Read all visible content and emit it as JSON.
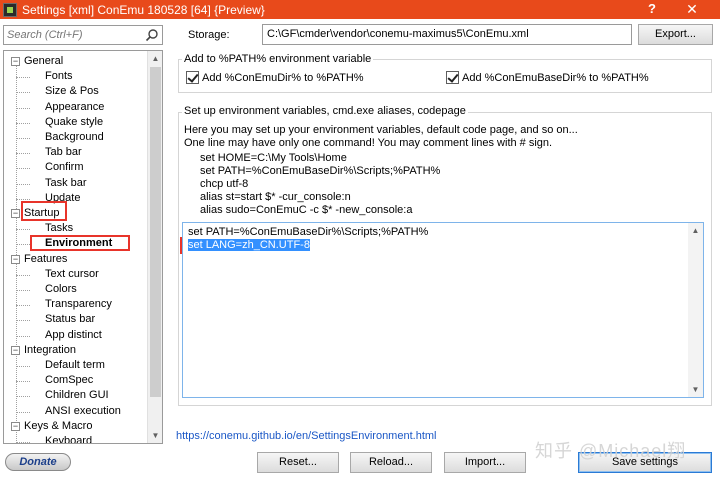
{
  "window": {
    "title": "Settings [xml] ConEmu 180528 [64] {Preview}",
    "help_label": "?",
    "close_label": "✕",
    "accent": "#e84a1b"
  },
  "search": {
    "placeholder": "Search (Ctrl+F)"
  },
  "tree": [
    {
      "label": "General",
      "level": 0,
      "expander": "−"
    },
    {
      "label": "Fonts",
      "level": 1
    },
    {
      "label": "Size & Pos",
      "level": 1
    },
    {
      "label": "Appearance",
      "level": 1
    },
    {
      "label": "Quake style",
      "level": 1
    },
    {
      "label": "Background",
      "level": 1
    },
    {
      "label": "Tab bar",
      "level": 1
    },
    {
      "label": "Confirm",
      "level": 1
    },
    {
      "label": "Task bar",
      "level": 1
    },
    {
      "label": "Update",
      "level": 1
    },
    {
      "label": "Startup",
      "level": 0,
      "expander": "−"
    },
    {
      "label": "Tasks",
      "level": 1
    },
    {
      "label": "Environment",
      "level": 1,
      "selected": true
    },
    {
      "label": "Features",
      "level": 0,
      "expander": "−"
    },
    {
      "label": "Text cursor",
      "level": 1
    },
    {
      "label": "Colors",
      "level": 1
    },
    {
      "label": "Transparency",
      "level": 1
    },
    {
      "label": "Status bar",
      "level": 1
    },
    {
      "label": "App distinct",
      "level": 1
    },
    {
      "label": "Integration",
      "level": 0,
      "expander": "−"
    },
    {
      "label": "Default term",
      "level": 1
    },
    {
      "label": "ComSpec",
      "level": 1
    },
    {
      "label": "Children GUI",
      "level": 1
    },
    {
      "label": "ANSI execution",
      "level": 1
    },
    {
      "label": "Keys & Macro",
      "level": 0,
      "expander": "−"
    },
    {
      "label": "Keyboard",
      "level": 1
    }
  ],
  "storage": {
    "label": "Storage:",
    "value": "C:\\GF\\cmder\\vendor\\conemu-maximus5\\ConEmu.xml",
    "export_label": "Export..."
  },
  "path_group": {
    "title": "Add to %PATH% environment variable",
    "check1": "Add %ConEmuDir% to %PATH%",
    "check2": "Add %ConEmuBaseDir% to %PATH%"
  },
  "env_group": {
    "title": "Set up environment variables, cmd.exe aliases, codepage",
    "desc1": "Here you may set up your environment variables, default code page, and so on...",
    "desc2": "One line may have only one command! You may comment lines with # sign.",
    "examples": [
      "set HOME=C:\\My Tools\\Home",
      "set PATH=%ConEmuBaseDir%\\Scripts;%PATH%",
      "chcp utf-8",
      "alias st=start $* -cur_console:n",
      "alias sudo=ConEmuC -c $* -new_console:a"
    ],
    "editor_lines": [
      "set PATH=%ConEmuBaseDir%\\Scripts;%PATH%",
      "set LANG=zh_CN.UTF-8"
    ]
  },
  "link": "https://conemu.github.io/en/SettingsEnvironment.html",
  "bottom": {
    "donate": "Donate",
    "reset": "Reset...",
    "reload": "Reload...",
    "import": "Import...",
    "save": "Save settings"
  },
  "watermark": "知乎 @Michael翔"
}
